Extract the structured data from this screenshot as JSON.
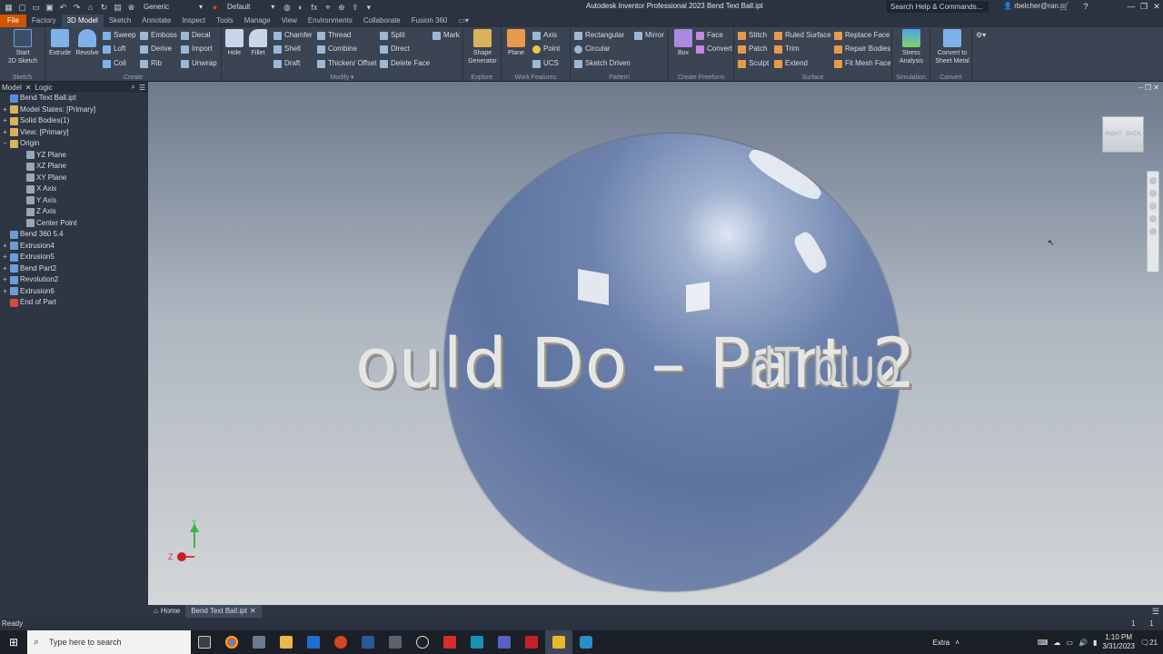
{
  "titlebar": {
    "title": "Autodesk Inventor Professional 2023    Bend Text Ball.ipt",
    "appearance": "Generic",
    "material": "Default",
    "fx": "fx",
    "help_search": "Search Help & Commands...",
    "user": "rbelcher@ran...",
    "help": "?"
  },
  "tabs": [
    "File",
    "Factory",
    "3D Model",
    "Sketch",
    "Annotate",
    "Inspect",
    "Tools",
    "Manage",
    "View",
    "Environments",
    "Collaborate",
    "Fusion 360"
  ],
  "ribbon": {
    "sketch": {
      "label": "Sketch",
      "start": "Start\n2D Sketch"
    },
    "create": {
      "label": "Create",
      "extrude": "Extrude",
      "revolve": "Revolve",
      "sweep": "Sweep",
      "loft": "Loft",
      "coil": "Coil",
      "emboss": "Emboss",
      "derive": "Derive",
      "rib": "Rib",
      "decal": "Decal",
      "import": "Import",
      "unwrap": "Unwrap"
    },
    "modify": {
      "label": "Modify",
      "hole": "Hole",
      "fillet": "Fillet",
      "chamfer": "Chamfer",
      "shell": "Shell",
      "draft": "Draft",
      "thread": "Thread",
      "combine": "Combine",
      "thicken": "Thicken/ Offset",
      "split": "Split",
      "direct": "Direct",
      "delete_face": "Delete Face",
      "mark": "Mark"
    },
    "explore": {
      "label": "Explore",
      "shape_gen": "Shape\nGenerator"
    },
    "work": {
      "label": "Work Features",
      "plane": "Plane",
      "axis": "Axis",
      "point": "Point",
      "ucs": "UCS"
    },
    "pattern": {
      "label": "Pattern",
      "rectangular": "Rectangular",
      "circular": "Circular",
      "sketch_driven": "Sketch Driven",
      "mirror": "Mirror"
    },
    "freeform": {
      "label": "Create Freeform",
      "box": "Box",
      "face": "Face",
      "convert": "Convert"
    },
    "surface": {
      "label": "Surface",
      "stitch": "Stitch",
      "patch": "Patch",
      "sculpt": "Sculpt",
      "ruled": "Ruled Surface",
      "trim": "Trim",
      "extend": "Extend",
      "replace": "Replace Face",
      "repair": "Repair Bodies",
      "fit_mesh": "Fit Mesh Face"
    },
    "simulation": {
      "label": "Simulation",
      "stress": "Stress\nAnalysis"
    },
    "convert": {
      "label": "Convert",
      "sheet_metal": "Convert to\nSheet Metal"
    }
  },
  "browser": {
    "tabs": [
      "Model",
      "Logic"
    ],
    "tree": [
      {
        "label": "Bend Text Ball.ipt",
        "pm": "",
        "color": "#5b8dd6"
      },
      {
        "label": "Model States: [Primary]",
        "pm": "+",
        "color": "#d9b25a"
      },
      {
        "label": "Solid Bodies(1)",
        "pm": "+",
        "color": "#d9b25a"
      },
      {
        "label": "View: [Primary]",
        "pm": "+",
        "color": "#d9b25a"
      },
      {
        "label": "Origin",
        "pm": "−",
        "color": "#d9b25a"
      },
      {
        "label": "YZ Plane",
        "pm": "",
        "color": "#9aa6b6"
      },
      {
        "label": "XZ Plane",
        "pm": "",
        "color": "#9aa6b6"
      },
      {
        "label": "XY Plane",
        "pm": "",
        "color": "#9aa6b6"
      },
      {
        "label": "X Axis",
        "pm": "",
        "color": "#9aa6b6"
      },
      {
        "label": "Y Axis",
        "pm": "",
        "color": "#9aa6b6"
      },
      {
        "label": "Z Axis",
        "pm": "",
        "color": "#9aa6b6"
      },
      {
        "label": "Center Point",
        "pm": "",
        "color": "#9aa6b6"
      },
      {
        "label": "Bend 360 5.4",
        "pm": "",
        "color": "#6f9bd8"
      },
      {
        "label": "Extrusion4",
        "pm": "+",
        "color": "#6f9bd8"
      },
      {
        "label": "Extrusion5",
        "pm": "+",
        "color": "#6f9bd8"
      },
      {
        "label": "Bend Part2",
        "pm": "+",
        "color": "#6f9bd8"
      },
      {
        "label": "Revolution2",
        "pm": "+",
        "color": "#6f9bd8"
      },
      {
        "label": "Extrusion6",
        "pm": "+",
        "color": "#6f9bd8"
      },
      {
        "label": "End of Part",
        "pm": "",
        "color": "#d14b3c"
      }
    ]
  },
  "viewport": {
    "text_main": "ould Do – Part 2",
    "text_right": "ould Th",
    "cube_faces": [
      "RIGHT",
      "BACK"
    ]
  },
  "doctabs": {
    "home": "Home",
    "file": "Bend Text Ball.ipt"
  },
  "status": {
    "text": "Ready",
    "counts": [
      "1",
      "1"
    ]
  },
  "taskbar": {
    "search_placeholder": "Type here to search",
    "extra": "Extra",
    "time": "1:10 PM",
    "date": "3/31/2023",
    "notif": "21"
  }
}
